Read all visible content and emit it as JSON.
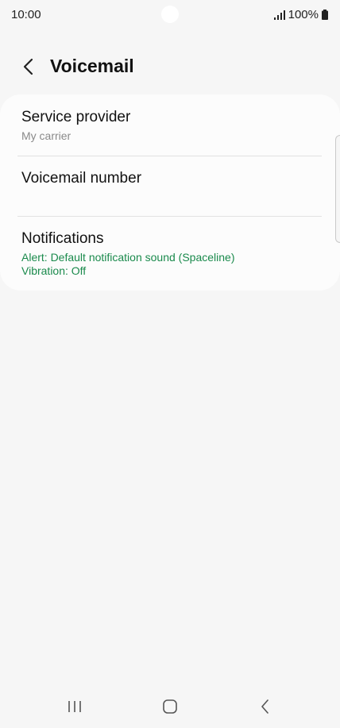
{
  "status_bar": {
    "time": "10:00",
    "battery": "100%",
    "icons": [
      "signal-icon",
      "battery-icon"
    ]
  },
  "header": {
    "title": "Voicemail",
    "back_icon": "chevron-left-icon"
  },
  "settings": {
    "service_provider": {
      "title": "Service provider",
      "subtitle": "My carrier"
    },
    "voicemail_number": {
      "title": "Voicemail number"
    },
    "notifications": {
      "title": "Notifications",
      "alert": "Alert: Default notification sound (Spaceline)",
      "vibration": "Vibration: Off"
    }
  },
  "nav_bar": {
    "icons": [
      "recent-apps-icon",
      "home-icon",
      "back-icon"
    ]
  },
  "colors": {
    "background": "#f6f6f6",
    "card": "#fcfcfc",
    "accent_green": "#1a8a4c",
    "secondary_text": "#8a8a8a"
  }
}
